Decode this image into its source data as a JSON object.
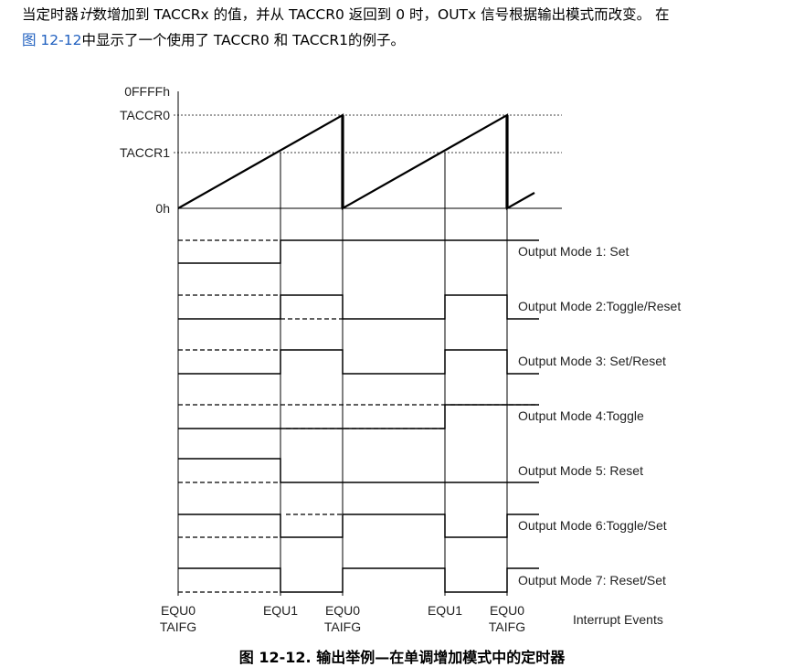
{
  "text": {
    "line1_a": "当定时器",
    "line1_em": "计",
    "line1_b": "数增加到 TACCRx 的值，并从 TACCR0 返回到 0 时，OUTx 信号根据输出模式而改变。 在",
    "line2_ref": "图 12-12",
    "line2_b": "中显示了一个使用了 TACCR0 和 TACCR1的例子。"
  },
  "figure": {
    "y_labels": [
      "0FFFFh",
      "TACCR0",
      "TACCR1",
      "0h"
    ],
    "modes": [
      "Output Mode 1: Set",
      "Output Mode 2:Toggle/Reset",
      "Output Mode 3: Set/Reset",
      "Output Mode 4:Toggle",
      "Output Mode 5: Reset",
      "Output Mode 6:Toggle/Set",
      "Output Mode 7: Reset/Set"
    ],
    "events": [
      {
        "top": "EQU0",
        "bottom": "TAIFG"
      },
      {
        "top": "EQU1",
        "bottom": ""
      },
      {
        "top": "EQU0",
        "bottom": "TAIFG"
      },
      {
        "top": "EQU1",
        "bottom": ""
      },
      {
        "top": "EQU0",
        "bottom": "TAIFG"
      }
    ],
    "events_label": "Interrupt Events",
    "caption": "图 12-12. 输出举例—在单调增加模式中的定时器"
  }
}
